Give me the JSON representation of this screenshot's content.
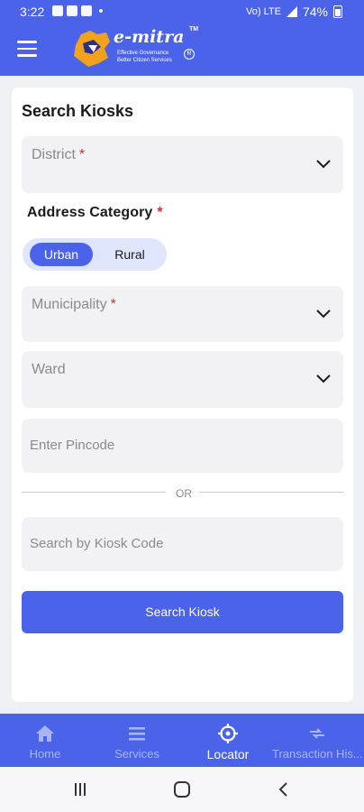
{
  "status_bar": {
    "time": "3:22",
    "network": "Vo) LTE",
    "battery": "74%"
  },
  "app": {
    "brand": "e-mitra",
    "tm": "TM",
    "tagline_1": "Effective Governance",
    "tagline_2": "Better Citizen Services",
    "badge": "R"
  },
  "form": {
    "title": "Search Kiosks",
    "district_label": "District",
    "required_mark": "*",
    "address_category_label": "Address Category",
    "category_options": [
      "Urban",
      "Rural"
    ],
    "category_selected": "Urban",
    "municipality_label": "Municipality",
    "ward_label": "Ward",
    "pincode_placeholder": "Enter Pincode",
    "or_text": "OR",
    "kiosk_code_placeholder": "Search by Kiosk Code",
    "search_button": "Search Kiosk"
  },
  "bottom_nav": [
    {
      "label": "Home",
      "icon": "home-icon",
      "active": false
    },
    {
      "label": "Services",
      "icon": "list-icon",
      "active": false
    },
    {
      "label": "Locator",
      "icon": "crosshair-icon",
      "active": true
    },
    {
      "label": "Transaction His...",
      "icon": "transfer-icon",
      "active": false
    }
  ],
  "colors": {
    "primary": "#4a63e8",
    "required": "#e0263a",
    "field_bg": "#f2f2f4",
    "toggle_bg": "#dfe6fb"
  }
}
